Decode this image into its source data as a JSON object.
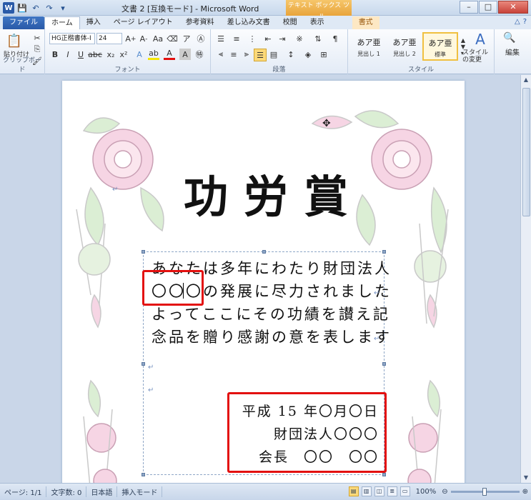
{
  "window": {
    "title": "文書 2 [互換モード] - Microsoft Word",
    "context_tab_group": "テキスト ボックス ツール"
  },
  "tabs": [
    "ファイル",
    "ホーム",
    "挿入",
    "ページ レイアウト",
    "参考資料",
    "差し込み文書",
    "校閲",
    "表示",
    "書式"
  ],
  "ribbon": {
    "clipboard": {
      "paste_label": "貼り付け",
      "group_label": "クリップボード"
    },
    "font": {
      "font_name": "HG正楷書体-I",
      "font_size": "24",
      "group_label": "フォント"
    },
    "paragraph": {
      "group_label": "段落"
    },
    "styles": {
      "items": [
        {
          "sample": "あア亜",
          "name": "見出し 1"
        },
        {
          "sample": "あア亜",
          "name": "見出し 2"
        },
        {
          "sample": "あア亜",
          "name": "標準"
        }
      ],
      "change_styles_label": "スタイルの変更",
      "group_label": "スタイル"
    },
    "editing": {
      "label": "編集"
    }
  },
  "document": {
    "title": "功労賞",
    "body_lines": [
      "あなたは多年にわたり財団法人",
      "〇〇〇の発展に尽力されました",
      "よってここにその功績を讃え記",
      "念品を贈り感謝の意を表します"
    ],
    "signature_lines": [
      "平成 15 年〇月〇日",
      "財団法人〇〇〇",
      "会長　〇〇　〇〇"
    ]
  },
  "status": {
    "page": "ページ: 1/1",
    "word_count": "文字数: 0",
    "language": "日本語",
    "mode": "挿入モード",
    "zoom": "100%"
  },
  "colors": {
    "highlight_box": "#e3100f",
    "file_tab": "#2a5aa8"
  }
}
